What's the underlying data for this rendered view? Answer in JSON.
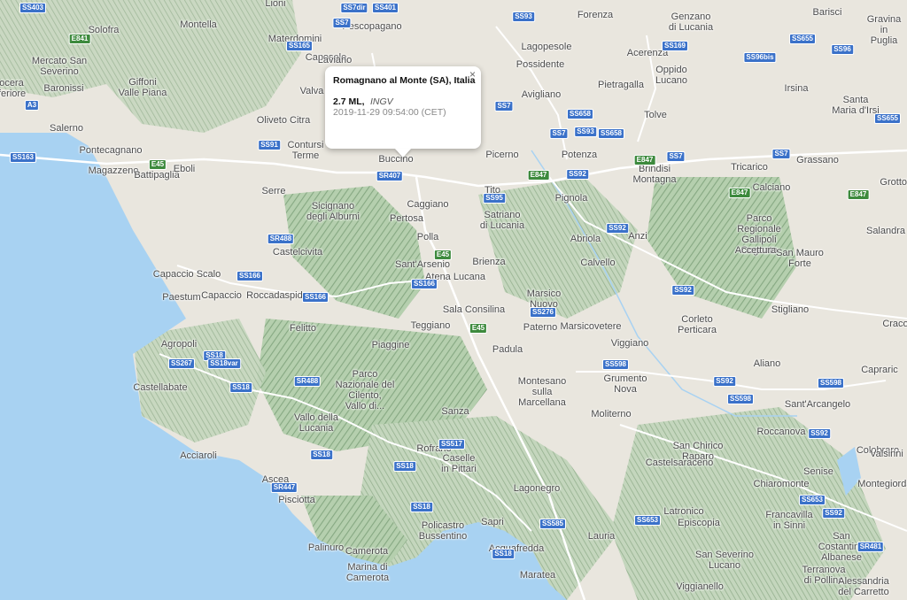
{
  "colors": {
    "sea": "#a8d2f2",
    "land": "#e9e6de",
    "mountain": "#aac7a4",
    "ridge": "#7ea478",
    "road": "#ffffff",
    "shield": "#3a71c9",
    "shield_green": "#3d8a3d"
  },
  "popup": {
    "title": "Romagnano al Monte (SA), Italia",
    "magnitude": "2.7 ML,",
    "source": "INGV",
    "time": "2019-11-29 09:54:00 (CET)",
    "close_icon": "×"
  },
  "places": [
    {
      "name": "Lioni"
    },
    {
      "name": "Pescopagano"
    },
    {
      "name": "Forenza"
    },
    {
      "name": "Genzano\ndi Lucania"
    },
    {
      "name": "Gravina\nin Puglia"
    },
    {
      "name": "Barisci"
    },
    {
      "name": "Solofra"
    },
    {
      "name": "Montella"
    },
    {
      "name": "Materdomini"
    },
    {
      "name": "Caposele"
    },
    {
      "name": "Lagopesole"
    },
    {
      "name": "Acerenza"
    },
    {
      "name": "Mercato San\nSeverino"
    },
    {
      "name": "Nocera\nInferiore"
    },
    {
      "name": "Baronissi"
    },
    {
      "name": "Giffoni\nValle Piana"
    },
    {
      "name": "Laviano"
    },
    {
      "name": "Possidente"
    },
    {
      "name": "Oppido\nLucano"
    },
    {
      "name": "Irsina"
    },
    {
      "name": "Valva"
    },
    {
      "name": "Avigliano"
    },
    {
      "name": "Pietragalla"
    },
    {
      "name": "Santa\nMaria d'Irsi"
    },
    {
      "name": "Salerno"
    },
    {
      "name": "Pontecagnano"
    },
    {
      "name": "Oliveto Citra"
    },
    {
      "name": "Contursi\nTerme"
    },
    {
      "name": "Tolve"
    },
    {
      "name": "Magazzeno"
    },
    {
      "name": "Battipaglia"
    },
    {
      "name": "Eboli"
    },
    {
      "name": "Buccino"
    },
    {
      "name": "Picerno"
    },
    {
      "name": "Potenza"
    },
    {
      "name": "Brindisi\nMontagna"
    },
    {
      "name": "Tricarico"
    },
    {
      "name": "Grassano"
    },
    {
      "name": "Serre"
    },
    {
      "name": "Caggiano"
    },
    {
      "name": "Tito"
    },
    {
      "name": "Pignola"
    },
    {
      "name": "Calciano"
    },
    {
      "name": "Grottole"
    },
    {
      "name": "Sicignano\ndegli Alburni"
    },
    {
      "name": "Pertosa"
    },
    {
      "name": "Satriano\ndi Lucania"
    },
    {
      "name": "Parco\nRegionale\nGallipoli\nCognato"
    },
    {
      "name": "Polla"
    },
    {
      "name": "Abriola"
    },
    {
      "name": "Anzi"
    },
    {
      "name": "Salandra"
    },
    {
      "name": "Castelcivita"
    },
    {
      "name": "Sant'Arsenio"
    },
    {
      "name": "Brienza"
    },
    {
      "name": "Accettura"
    },
    {
      "name": "San Mauro\nForte"
    },
    {
      "name": "Capaccio Scalo"
    },
    {
      "name": "Atena Lucana"
    },
    {
      "name": "Calvello"
    },
    {
      "name": "Paestum"
    },
    {
      "name": "Capaccio"
    },
    {
      "name": "Roccadaspide"
    },
    {
      "name": "Marsico\nNuovo"
    },
    {
      "name": "Sala Consilina"
    },
    {
      "name": "Stigliano"
    },
    {
      "name": "Corleto\nPerticara"
    },
    {
      "name": "Felitto"
    },
    {
      "name": "Teggiano"
    },
    {
      "name": "Paterno"
    },
    {
      "name": "Marsicovetere"
    },
    {
      "name": "Agropoli"
    },
    {
      "name": "Piaggine"
    },
    {
      "name": "Viggiano"
    },
    {
      "name": "Craco"
    },
    {
      "name": "Padula"
    },
    {
      "name": "Parco\nNazionale del\nCilento,\nVallo di..."
    },
    {
      "name": "Aliano"
    },
    {
      "name": "Capraric"
    },
    {
      "name": "Castellabate"
    },
    {
      "name": "Montesano\nsulla\nMarcellana"
    },
    {
      "name": "Grumento\nNova"
    },
    {
      "name": "Sant'Arcangelo"
    },
    {
      "name": "Vallo della\nLucania"
    },
    {
      "name": "Sanza"
    },
    {
      "name": "Moliterno"
    },
    {
      "name": "Roccanova"
    },
    {
      "name": "San Chirico\nRaparo"
    },
    {
      "name": "Colobraro"
    },
    {
      "name": "Acciaroli"
    },
    {
      "name": "Rofrano"
    },
    {
      "name": "Caselle\nin Pittari"
    },
    {
      "name": "Castelsaraceno"
    },
    {
      "name": "Senise"
    },
    {
      "name": "Valsinni"
    },
    {
      "name": "Ascea"
    },
    {
      "name": "Montegiordano"
    },
    {
      "name": "Lagonegro"
    },
    {
      "name": "Chiaromonte"
    },
    {
      "name": "Pisciotta"
    },
    {
      "name": "Latronico"
    },
    {
      "name": "Francavilla\nin Sinni"
    },
    {
      "name": "Policastro\nBussentino"
    },
    {
      "name": "Sapri"
    },
    {
      "name": "Episcopia"
    },
    {
      "name": "Palinuro"
    },
    {
      "name": "Camerota"
    },
    {
      "name": "Lauria"
    },
    {
      "name": "Acquafredda"
    },
    {
      "name": "San Costantino\nAlbanese"
    },
    {
      "name": "Marina di\nCamerota"
    },
    {
      "name": "San Severino\nLucano"
    },
    {
      "name": "Maratea"
    },
    {
      "name": "Terranova\ndi Pollino"
    },
    {
      "name": "Viggianello"
    },
    {
      "name": "Alessandria\ndel Carretto"
    }
  ],
  "shields": [
    {
      "label": "SS403"
    },
    {
      "label": "SS7dir"
    },
    {
      "label": "SS401"
    },
    {
      "label": "SS93"
    },
    {
      "label": "SS7"
    },
    {
      "label": "E841"
    },
    {
      "label": "SS169"
    },
    {
      "label": "SS655"
    },
    {
      "label": "SS96"
    },
    {
      "label": "SS165"
    },
    {
      "label": "SS96bis"
    },
    {
      "label": "A3"
    },
    {
      "label": "SS7"
    },
    {
      "label": "SS658"
    },
    {
      "label": "SS655"
    },
    {
      "label": "SS7"
    },
    {
      "label": "SS93"
    },
    {
      "label": "SS658"
    },
    {
      "label": "SS91"
    },
    {
      "label": "SS163"
    },
    {
      "label": "SS7"
    },
    {
      "label": "E847"
    },
    {
      "label": "SS7"
    },
    {
      "label": "E45"
    },
    {
      "label": "SR407"
    },
    {
      "label": "E847"
    },
    {
      "label": "SS92"
    },
    {
      "label": "E847"
    },
    {
      "label": "E847"
    },
    {
      "label": "SS95"
    },
    {
      "label": "SS92"
    },
    {
      "label": "SR488"
    },
    {
      "label": "E45"
    },
    {
      "label": "SS166"
    },
    {
      "label": "SS166"
    },
    {
      "label": "SS166"
    },
    {
      "label": "SS92"
    },
    {
      "label": "SS276"
    },
    {
      "label": "E45"
    },
    {
      "label": "SS18"
    },
    {
      "label": "SS267"
    },
    {
      "label": "SS18var"
    },
    {
      "label": "SS598"
    },
    {
      "label": "SS18"
    },
    {
      "label": "SR488"
    },
    {
      "label": "SS92"
    },
    {
      "label": "SS598"
    },
    {
      "label": "SS598"
    },
    {
      "label": "SS92"
    },
    {
      "label": "SS517"
    },
    {
      "label": "SS18"
    },
    {
      "label": "SS18"
    },
    {
      "label": "SR447"
    },
    {
      "label": "SS653"
    },
    {
      "label": "SS92"
    },
    {
      "label": "SS18"
    },
    {
      "label": "SS585"
    },
    {
      "label": "SS653"
    },
    {
      "label": "SS18"
    },
    {
      "label": "SR481"
    }
  ]
}
